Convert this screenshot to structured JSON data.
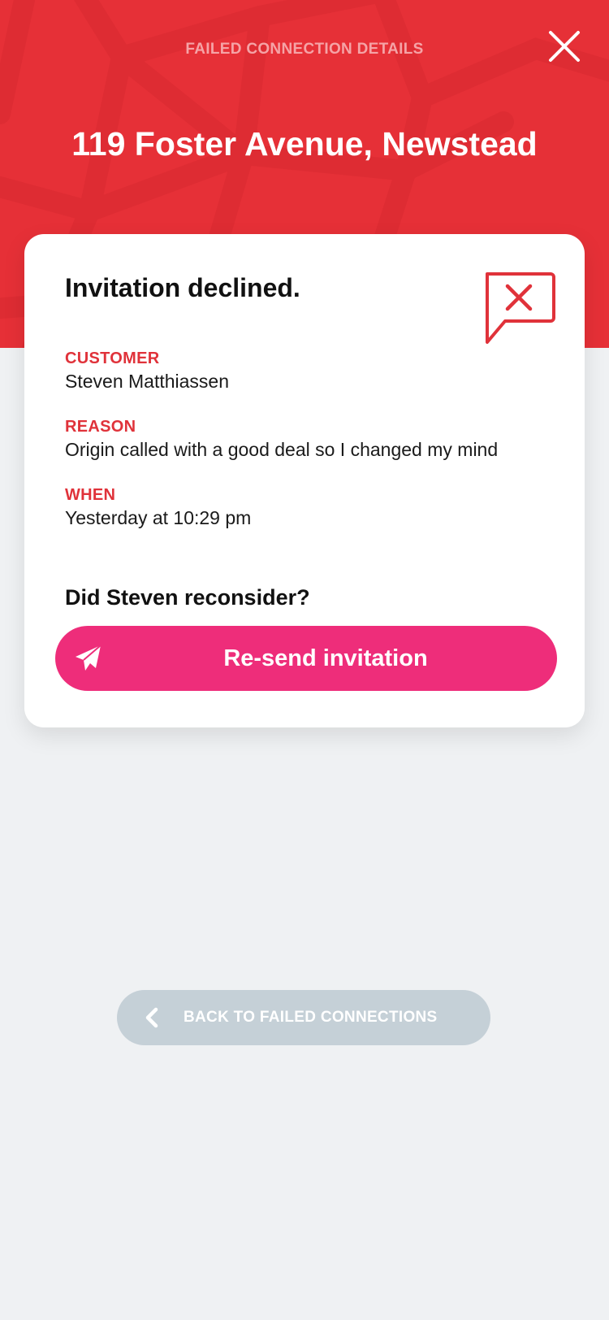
{
  "header": {
    "label": "FAILED CONNECTION DETAILS",
    "title": "119 Foster Avenue, Newstead",
    "close_icon": "close-icon",
    "background_color": "#e63037"
  },
  "card": {
    "title": "Invitation declined.",
    "status_icon": "declined-message-icon",
    "fields": [
      {
        "label": "CUSTOMER",
        "value": "Steven Matthiassen"
      },
      {
        "label": "REASON",
        "value": "Origin called with a good deal so I changed my mind"
      },
      {
        "label": "WHEN",
        "value": "Yesterday at 10:29 pm"
      }
    ],
    "question": "Did Steven reconsider?",
    "resend_button": {
      "label": "Re-send invitation",
      "icon": "paper-plane-icon",
      "color": "#ee2d7a"
    }
  },
  "footer": {
    "back_button": {
      "label": "BACK TO FAILED CONNECTIONS",
      "icon": "chevron-left-icon"
    }
  },
  "colors": {
    "accent_red": "#e0323a",
    "page_background": "#eff1f3"
  }
}
